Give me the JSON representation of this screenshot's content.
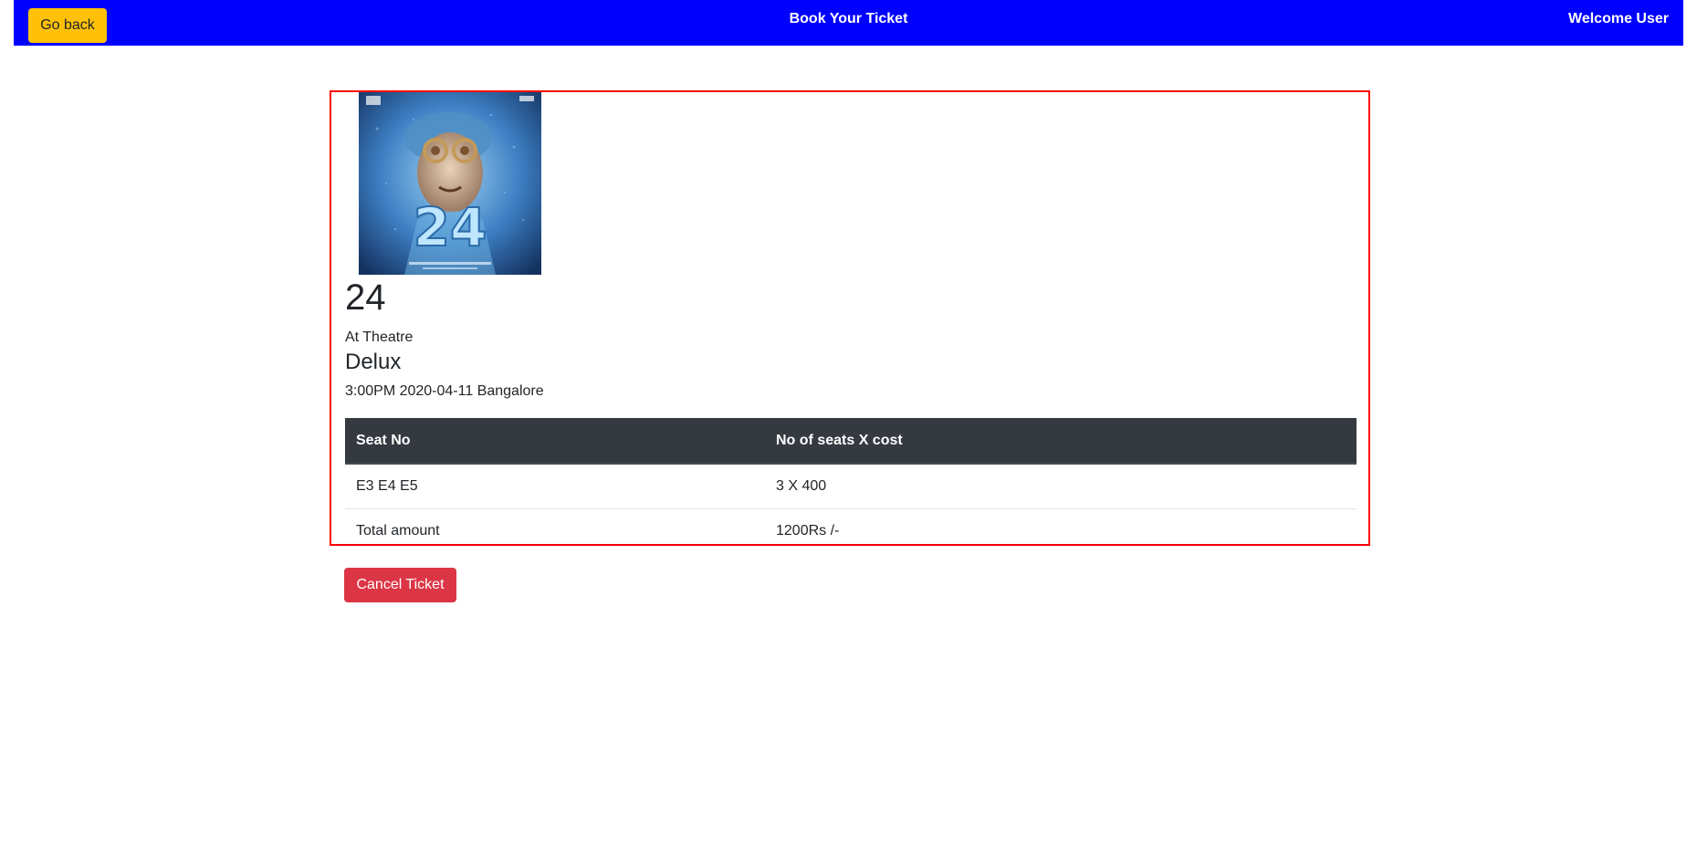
{
  "navbar": {
    "back_label": "Go back",
    "title": "Book Your Ticket",
    "welcome": "Welcome User",
    "background_color": "#0000ff",
    "back_button_color": "#ffc107"
  },
  "ticket": {
    "poster_icon": "movie-poster-image",
    "movie_title": "24",
    "at_theatre_label": "At Theatre",
    "theatre_name": "Delux",
    "show_details": "3:00PM 2020-04-11 Bangalore",
    "border_color": "#ff0000",
    "table": {
      "headers": [
        "Seat No",
        "No of seats X cost"
      ],
      "rows": [
        [
          "E3 E4 E5",
          "3 X 400"
        ],
        [
          "Total amount",
          "1200Rs /-"
        ]
      ]
    }
  },
  "actions": {
    "cancel_label": "Cancel Ticket",
    "cancel_color": "#dc3545"
  }
}
